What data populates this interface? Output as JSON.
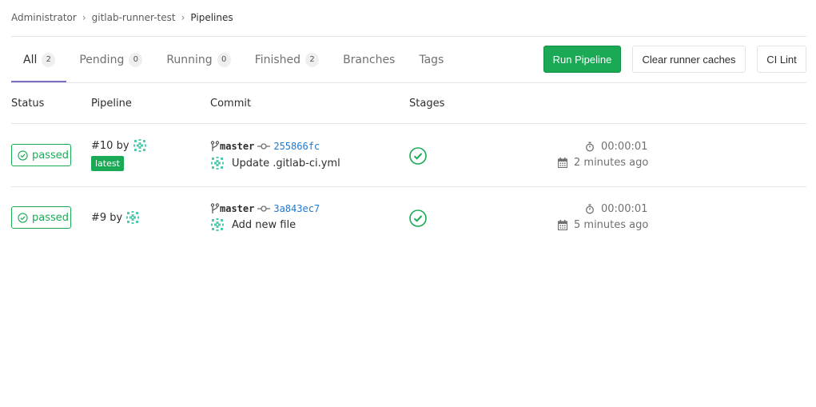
{
  "breadcrumb": {
    "items": [
      "Administrator",
      "gitlab-runner-test",
      "Pipelines"
    ]
  },
  "tabs": [
    {
      "label": "All",
      "count": "2"
    },
    {
      "label": "Pending",
      "count": "0"
    },
    {
      "label": "Running",
      "count": "0"
    },
    {
      "label": "Finished",
      "count": "2"
    },
    {
      "label": "Branches"
    },
    {
      "label": "Tags"
    }
  ],
  "actions": {
    "run_pipeline": "Run Pipeline",
    "clear_caches": "Clear runner caches",
    "ci_lint": "CI Lint"
  },
  "table": {
    "headers": [
      "Status",
      "Pipeline",
      "Commit",
      "Stages"
    ],
    "rows": [
      {
        "status": "passed",
        "pipeline_id": "#10 by",
        "badge": "latest",
        "branch": "master",
        "sha": "255866fc",
        "commit_title": "Update .gitlab-ci.yml",
        "duration": "00:00:01",
        "finished_ago": "2 minutes ago"
      },
      {
        "status": "passed",
        "pipeline_id": "#9 by",
        "branch": "master",
        "sha": "3a843ec7",
        "commit_title": "Add new file",
        "duration": "00:00:01",
        "finished_ago": "5 minutes ago"
      }
    ]
  },
  "colors": {
    "success": "#1aaa55",
    "link": "#1f78d1",
    "tab_active": "#7b6fc4"
  }
}
